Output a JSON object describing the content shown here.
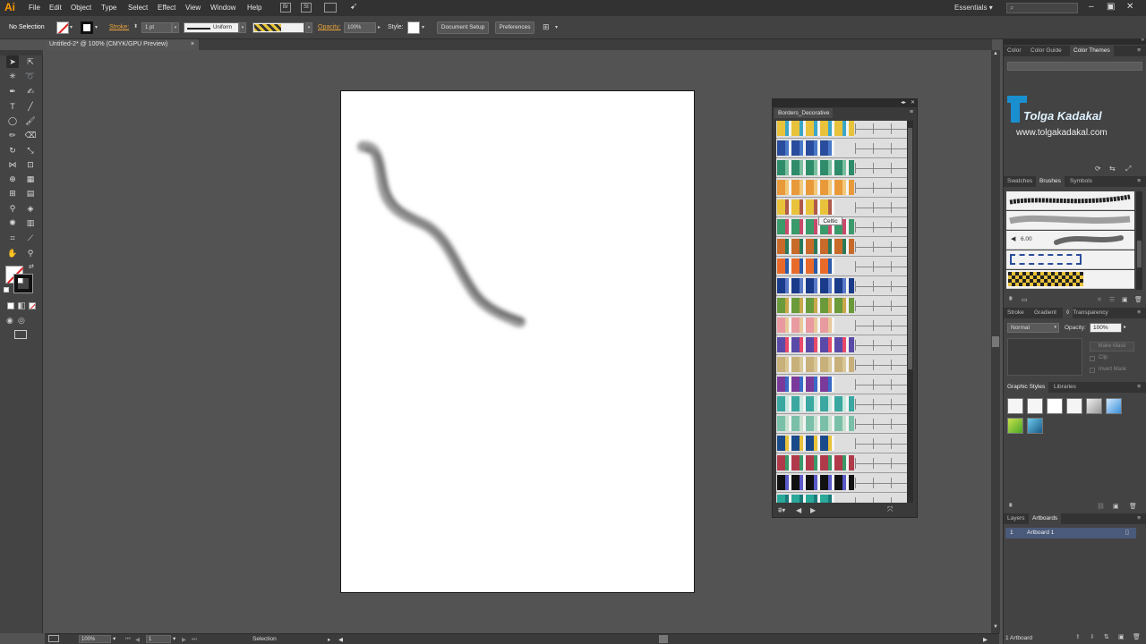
{
  "app": {
    "logo": "Ai"
  },
  "menu": [
    "File",
    "Edit",
    "Object",
    "Type",
    "Select",
    "Effect",
    "View",
    "Window",
    "Help"
  ],
  "bridge": {
    "br": "Br",
    "st": "St"
  },
  "workspace": {
    "label": "Essentials",
    "search_placeholder": ""
  },
  "control_bar": {
    "selection": "No Selection",
    "stroke_label": "Stroke:",
    "stroke_weight": "1 pt",
    "profile": "Uniform",
    "opacity_label": "Opacity:",
    "opacity_value": "100%",
    "style_label": "Style:",
    "document_setup": "Document Setup",
    "preferences": "Preferences"
  },
  "document": {
    "tab_title": "Untitled-2* @ 100% (CMYK/GPU Preview)",
    "close": "×"
  },
  "status_bar": {
    "zoom": "100%",
    "artboard_num": "1",
    "tool": "Selection"
  },
  "brush_library": {
    "title": "Borders_Decorative",
    "tooltip": "Celtic",
    "rows": [
      {
        "colors": [
          "#e8c23a",
          "#3aa6c8"
        ]
      },
      {
        "colors": [
          "#2a4c9c",
          "#4a78c8"
        ]
      },
      {
        "colors": [
          "#2e8c6a",
          "#7ac0a0"
        ]
      },
      {
        "colors": [
          "#e89a3a",
          "#f2c87a"
        ]
      },
      {
        "colors": [
          "#e8c23a",
          "#b05a4a"
        ]
      },
      {
        "colors": [
          "#3a9a6a",
          "#c84a6a"
        ]
      },
      {
        "colors": [
          "#c86a2a",
          "#2a7a5a"
        ]
      },
      {
        "colors": [
          "#e86a2a",
          "#2a5aa8"
        ]
      },
      {
        "colors": [
          "#1a3a8a",
          "#5a7ac8"
        ]
      },
      {
        "colors": [
          "#6a9a3a",
          "#c8a84a"
        ]
      },
      {
        "colors": [
          "#e89aa0",
          "#e8c89a"
        ]
      },
      {
        "colors": [
          "#5a4aa8",
          "#e84a6a"
        ]
      },
      {
        "colors": [
          "#c8b07a",
          "#d8c898"
        ]
      },
      {
        "colors": [
          "#7a3a9a",
          "#3a6ac8"
        ]
      },
      {
        "colors": [
          "#3aa8a0",
          "#c8e8e0"
        ]
      },
      {
        "colors": [
          "#7ac0a8",
          "#c8e0d0"
        ]
      },
      {
        "colors": [
          "#1a4a8a",
          "#e8c23a"
        ]
      },
      {
        "colors": [
          "#b03a4a",
          "#3a9a6a"
        ]
      },
      {
        "colors": [
          "#111111",
          "#5a5ac8"
        ]
      },
      {
        "colors": [
          "#2aa89a",
          "#1a7a7a"
        ]
      }
    ]
  },
  "color_panel": {
    "tabs": [
      "Color",
      "Color Guide",
      "Color Themes"
    ],
    "brand_name": "Tolga Kadakal",
    "brand_url": "www.tolgakadakal.com"
  },
  "brushes_panel": {
    "tabs": [
      "Swatches",
      "Brushes",
      "Symbols"
    ],
    "size_label": "6.00"
  },
  "transparency_panel": {
    "tabs": [
      "Stroke",
      "Gradient",
      "Transparency"
    ],
    "blend_mode": "Normal",
    "opacity_label": "Opacity:",
    "opacity_value": "100%",
    "make_mask": "Make Mask",
    "clip": "Clip",
    "invert_mask": "Invert Mask"
  },
  "graphic_styles_panel": {
    "tabs": [
      "Graphic Styles",
      "Libraries"
    ]
  },
  "layers_panel": {
    "tabs": [
      "Layers",
      "Artboards"
    ],
    "artboards": [
      {
        "num": "1",
        "name": "Artboard 1"
      }
    ],
    "count": "1 Artboard"
  },
  "colors": {
    "accent": "#e8a23b",
    "panel_bg": "#434343",
    "canvas_bg": "#535353",
    "brand_blue": "#1a8fcf"
  }
}
